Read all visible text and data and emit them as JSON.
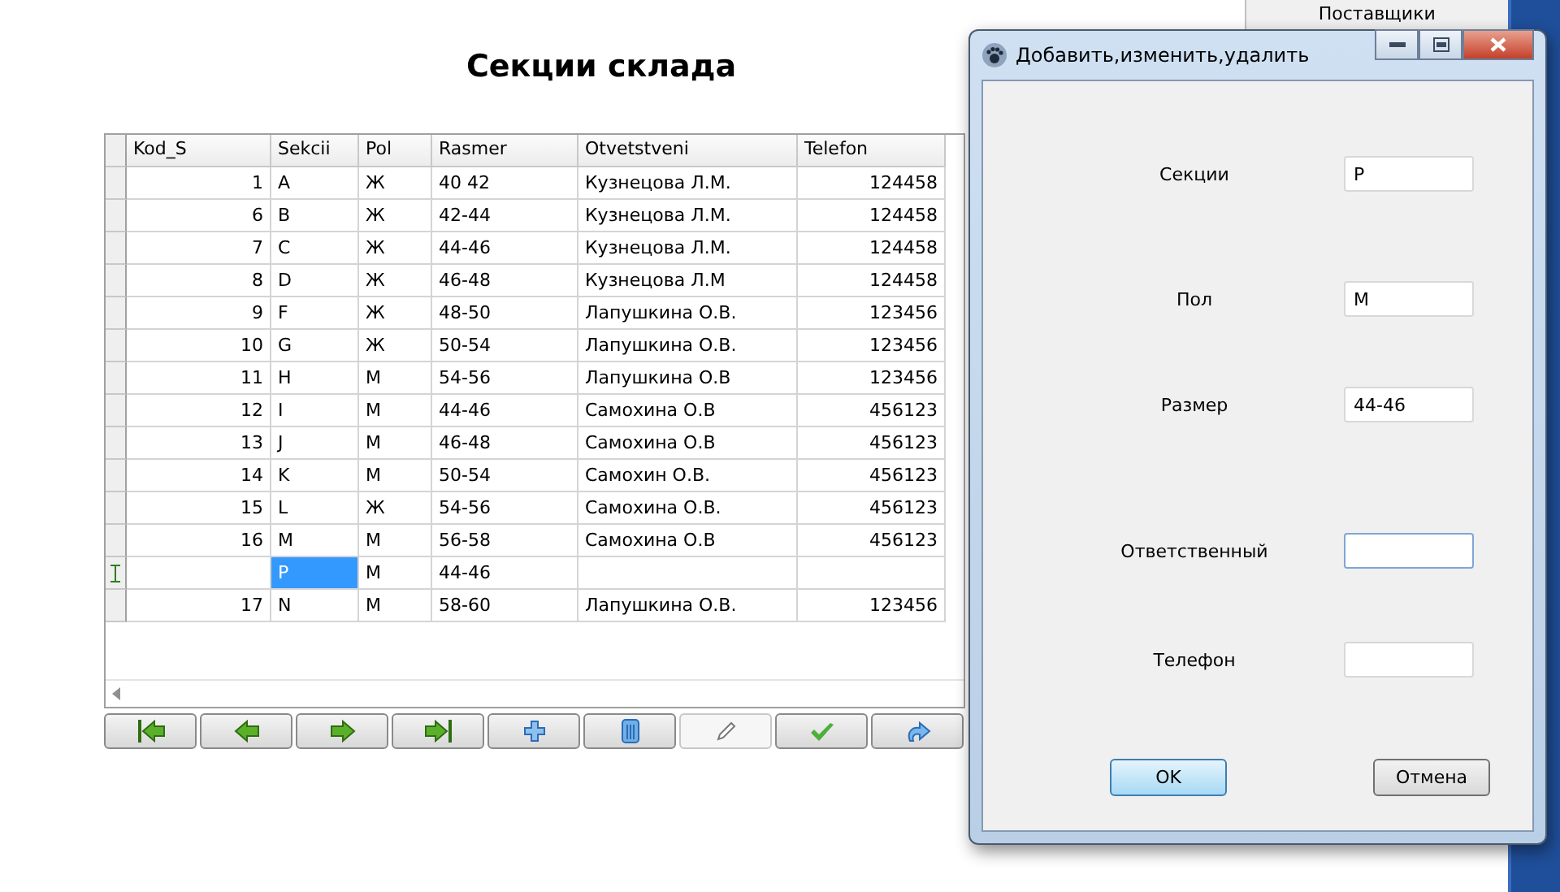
{
  "page_title": "Секции склада",
  "table": {
    "columns": [
      "Kod_S",
      "Sekcii",
      "Pol",
      "Rasmer",
      "Otvetstveni",
      "Telefon"
    ],
    "rows": [
      {
        "cells": [
          "1",
          "A",
          "Ж",
          "40 42",
          "Кузнецова Л.М.",
          "124458"
        ],
        "current": false
      },
      {
        "cells": [
          "6",
          "B",
          "Ж",
          "42-44",
          "Кузнецова Л.М.",
          "124458"
        ],
        "current": false
      },
      {
        "cells": [
          "7",
          "C",
          "Ж",
          "44-46",
          "Кузнецова Л.М.",
          "124458"
        ],
        "current": false
      },
      {
        "cells": [
          "8",
          "D",
          "Ж",
          "46-48",
          "Кузнецова Л.М",
          "124458"
        ],
        "current": false
      },
      {
        "cells": [
          "9",
          "F",
          "Ж",
          "48-50",
          "Лапушкина О.В.",
          "123456"
        ],
        "current": false
      },
      {
        "cells": [
          "10",
          "G",
          "Ж",
          "50-54",
          "Лапушкина О.В.",
          "123456"
        ],
        "current": false
      },
      {
        "cells": [
          "11",
          "H",
          "М",
          "54-56",
          "Лапушкина О.В",
          "123456"
        ],
        "current": false
      },
      {
        "cells": [
          "12",
          "I",
          "М",
          "44-46",
          "Самохина О.В",
          "456123"
        ],
        "current": false
      },
      {
        "cells": [
          "13",
          "J",
          "М",
          "46-48",
          "Самохина О.В",
          "456123"
        ],
        "current": false
      },
      {
        "cells": [
          "14",
          "K",
          "М",
          "50-54",
          "Самохин О.В.",
          "456123"
        ],
        "current": false
      },
      {
        "cells": [
          "15",
          "L",
          "Ж",
          "54-56",
          "Самохина О.В.",
          "456123"
        ],
        "current": false
      },
      {
        "cells": [
          "16",
          "M",
          "М",
          "56-58",
          "Самохина О.В",
          "456123"
        ],
        "current": false
      },
      {
        "cells": [
          "",
          "P",
          "М",
          "44-46",
          "",
          ""
        ],
        "current": true,
        "selected_cells": [
          false,
          true,
          false,
          false,
          false,
          false
        ]
      },
      {
        "cells": [
          "17",
          "N",
          "М",
          "58-60",
          "Лапушкина О.В.",
          "123456"
        ],
        "current": false
      }
    ]
  },
  "navigator": [
    {
      "kind": "first",
      "disabled": false
    },
    {
      "kind": "prior",
      "disabled": false
    },
    {
      "kind": "next",
      "disabled": false
    },
    {
      "kind": "last",
      "disabled": false
    },
    {
      "kind": "insert",
      "disabled": false
    },
    {
      "kind": "delete",
      "disabled": false
    },
    {
      "kind": "edit",
      "disabled": true
    },
    {
      "kind": "post",
      "disabled": false
    },
    {
      "kind": "cancel",
      "disabled": false
    }
  ],
  "background_button": "Поставщики",
  "dialog": {
    "title": "Добавить,изменить,удалить",
    "fields": [
      {
        "label": "Секции",
        "value": "P",
        "focused": false
      },
      {
        "label": "Пол",
        "value": "M",
        "focused": false
      },
      {
        "label": "Размер",
        "value": "44-46",
        "focused": false
      },
      {
        "label": "Ответственный",
        "focused": true
      },
      {
        "label": "Телефон",
        "focused": false
      }
    ],
    "buttons": [
      {
        "label": "OK",
        "default": true
      },
      {
        "label": "Отмена",
        "default": false
      }
    ]
  }
}
